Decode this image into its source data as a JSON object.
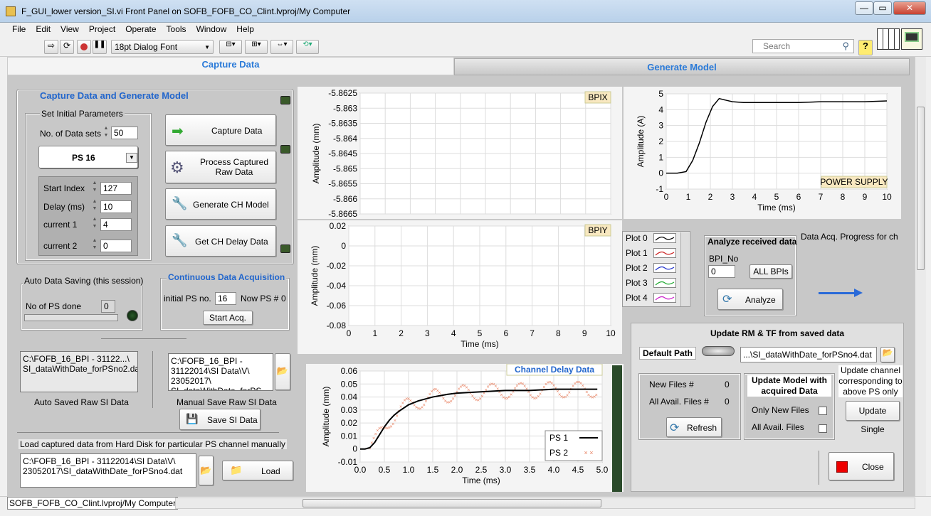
{
  "window": {
    "title": "F_GUI_lower version_SI.vi Front Panel on SOFB_FOFB_CO_Clint.lvproj/My Computer",
    "min": "—",
    "max": "▭",
    "close": "✕"
  },
  "menu": [
    "File",
    "Edit",
    "View",
    "Project",
    "Operate",
    "Tools",
    "Window",
    "Help"
  ],
  "toolbar": {
    "font": "18pt Dialog Font",
    "search_placeholder": "Search"
  },
  "tabs": {
    "capture": "Capture Data",
    "generate": "Generate Model"
  },
  "capture": {
    "title": "Capture Data and Generate Model",
    "set_params": "Set Initial Parameters",
    "nsets_label": "No. of Data sets",
    "nsets": "50",
    "ps_select": "PS 16",
    "start_index_label": "Start Index",
    "start_index": "127",
    "delay_label": "Delay (ms)",
    "delay": "10",
    "current1_label": "current 1",
    "current1": "4",
    "current2_label": "current 2",
    "current2": "0",
    "btn_capture": "Capture Data",
    "btn_process": "Process Captured Raw Data",
    "btn_generate": "Generate CH Model",
    "btn_delay": "Get CH Delay Data"
  },
  "auto_save": {
    "title": "Auto Data Saving (this session)",
    "ps_done_label": "No of PS done",
    "ps_done": "0"
  },
  "continuous": {
    "title": "Continuous Data Acquisition",
    "initial_label": "initial PS no.",
    "initial": "16",
    "now_label": "Now PS #",
    "now": "0",
    "start": "Start Acq."
  },
  "paths": {
    "auto_path": "C:\\FOFB_16_BPI - 31122...\\ SI_dataWithDate_forPSno2.dat",
    "auto_label": "Auto Saved Raw SI Data",
    "manual_path": "C:\\FOFB_16_BPI - 31122014\\SI Data\\V\\ 23052017\\ SI_dataWithDate_forPS",
    "manual_label": "Manual Save Raw SI Data",
    "save_btn": "Save SI Data",
    "load_label": "Load captured data from Hard Disk for particular PS channel manually",
    "load_path": "C:\\FOFB_16_BPI - 31122014\\SI Data\\V\\ 23052017\\SI_dataWithDate_forPSno4.dat",
    "load_btn": "Load"
  },
  "plot_legend": [
    "Plot 0",
    "Plot 1",
    "Plot 2",
    "Plot 3",
    "Plot 4"
  ],
  "plot_colors": [
    "#000000",
    "#cc2222",
    "#2233cc",
    "#22aa33",
    "#cc22cc"
  ],
  "analyze": {
    "title": "Analyze received data",
    "bpi_label": "BPI_No",
    "bpi": "0",
    "all_bpis": "ALL BPIs",
    "btn": "Analyze",
    "progress": "Data Acq. Progress for ch"
  },
  "update": {
    "title": "Update RM & TF from saved data",
    "default_path": "Default Path",
    "path": "...\\SI_dataWithDate_forPSno4.dat",
    "new_files_label": "New Files #",
    "new_files": "0",
    "all_files_label": "All Avail. Files #",
    "all_files": "0",
    "refresh": "Refresh",
    "update_model": "Update Model with acquired Data",
    "only_new": "Only New Files",
    "all_avail": "All Avail. Files",
    "update_channel": "Update channel corresponding to above PS only",
    "update_single": "Update Single",
    "close": "Close"
  },
  "status": {
    "project": "SOFB_FOFB_CO_Clint.lvproj/My Computer"
  },
  "chart_data": [
    {
      "type": "line",
      "title": "BPIX",
      "ylabel": "Amplitude (mm)",
      "xlabel": "",
      "ylim": [
        -5.8665,
        -5.8625
      ],
      "yticks": [
        "-5.8625",
        "-5.863",
        "-5.8635",
        "-5.864",
        "-5.8645",
        "-5.865",
        "-5.8655",
        "-5.866",
        "-5.8665"
      ],
      "series": []
    },
    {
      "type": "line",
      "title": "BPIY",
      "ylabel": "Amplitude (mm)",
      "xlabel": "Time (ms)",
      "xlim": [
        0,
        10
      ],
      "ylim": [
        -0.08,
        0.02
      ],
      "xticks": [
        "0",
        "1",
        "2",
        "3",
        "4",
        "5",
        "6",
        "7",
        "8",
        "9",
        "10"
      ],
      "yticks": [
        "0.02",
        "0",
        "-0.02",
        "-0.04",
        "-0.06",
        "-0.08"
      ],
      "series": []
    },
    {
      "type": "line",
      "title": "POWER SUPPLY",
      "ylabel": "Amplitude (A)",
      "xlabel": "Time (ms)",
      "xlim": [
        0,
        10
      ],
      "ylim": [
        -1,
        5
      ],
      "xticks": [
        "0",
        "1",
        "2",
        "3",
        "4",
        "5",
        "6",
        "7",
        "8",
        "9",
        "10"
      ],
      "yticks": [
        "5",
        "4",
        "3",
        "2",
        "1",
        "0",
        "-1"
      ],
      "x": [
        0,
        0.5,
        0.9,
        1.2,
        1.5,
        1.8,
        2.1,
        2.4,
        2.7,
        3.0,
        3.5,
        4,
        5,
        6,
        7,
        8,
        9,
        10
      ],
      "y": [
        0,
        0,
        0.1,
        0.8,
        1.9,
        3.2,
        4.2,
        4.7,
        4.6,
        4.5,
        4.45,
        4.45,
        4.45,
        4.45,
        4.5,
        4.5,
        4.5,
        4.55
      ]
    },
    {
      "type": "line",
      "title": "Channel Delay Data",
      "ylabel": "Amplitude (mm)",
      "xlabel": "Time (ms)",
      "xlim": [
        0,
        5
      ],
      "ylim": [
        -0.01,
        0.06
      ],
      "xticks": [
        "0.0",
        "0.5",
        "1.0",
        "1.5",
        "2.0",
        "2.5",
        "3.0",
        "3.5",
        "4.0",
        "4.5",
        "5.0"
      ],
      "yticks": [
        "0.06",
        "0.05",
        "0.04",
        "0.03",
        "0.02",
        "0.01",
        "0",
        "-0.01"
      ],
      "legend": [
        "PS 1",
        "PS 2"
      ],
      "x": [
        0,
        0.1,
        0.2,
        0.3,
        0.4,
        0.5,
        0.6,
        0.7,
        0.8,
        1.0,
        1.2,
        1.5,
        1.8,
        2.0,
        2.5,
        3.0,
        3.5,
        4.0,
        4.5,
        4.9
      ],
      "y": [
        0,
        0,
        0.001,
        0.005,
        0.011,
        0.017,
        0.022,
        0.026,
        0.029,
        0.034,
        0.037,
        0.04,
        0.042,
        0.043,
        0.044,
        0.045,
        0.045,
        0.046,
        0.046,
        0.046
      ]
    }
  ]
}
